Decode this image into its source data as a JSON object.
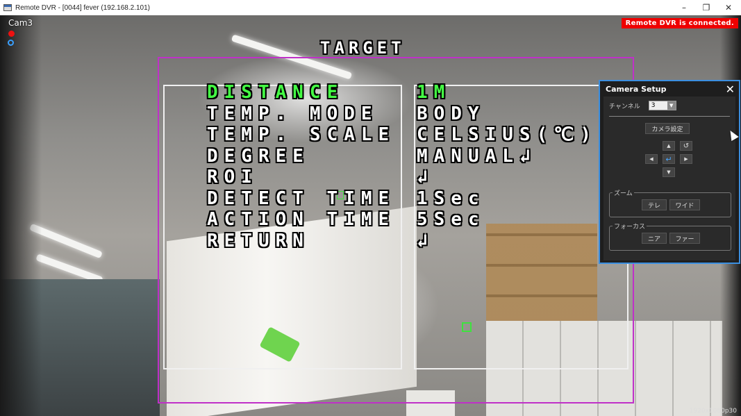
{
  "window": {
    "title": "Remote DVR - [0044] fever (192.168.2.101)",
    "minimize_glyph": "–",
    "restore_glyph": "❐",
    "close_glyph": "✕"
  },
  "video": {
    "camera_label": "Cam3",
    "connection_status": "Remote DVR is connected.",
    "resolution_label": "1920x1080p30"
  },
  "osd_menu": {
    "title": "TARGET",
    "items": [
      {
        "label": "DISTANCE",
        "value": "1M",
        "selected": true
      },
      {
        "label": "TEMP. MODE",
        "value": "BODY",
        "selected": false
      },
      {
        "label": "TEMP. SCALE",
        "value": "CELSIUS(℃)",
        "selected": false
      },
      {
        "label": "DEGREE",
        "value": "MANUAL↲",
        "selected": false
      },
      {
        "label": "ROI",
        "value": "↲",
        "selected": false
      },
      {
        "label": "DETECT TIME",
        "value": "1Sec",
        "selected": false
      },
      {
        "label": "ACTION TIME",
        "value": "5Sec",
        "selected": false
      },
      {
        "label": "RETURN",
        "value": "↲",
        "selected": false
      }
    ]
  },
  "camera_setup": {
    "title": "Camera Setup",
    "close_glyph": "✕",
    "channel_label": "チャンネル",
    "channel_value": "3",
    "dropdown_glyph": "▼",
    "camera_settings_button": "カメラ設定",
    "ptz": {
      "up": "▲",
      "down": "▼",
      "left": "◀",
      "right": "▶",
      "enter": "↵",
      "rotate": "↺"
    },
    "zoom_group": {
      "label": "ズーム",
      "tele": "テレ",
      "wide": "ワイド"
    },
    "focus_group": {
      "label": "フォーカス",
      "near": "ニア",
      "far": "ファー"
    }
  },
  "colors": {
    "roi_outer": "#c030c8",
    "selected_text": "#44ff44",
    "badge": "#e00000",
    "dialog_border": "#3b8fe0"
  }
}
